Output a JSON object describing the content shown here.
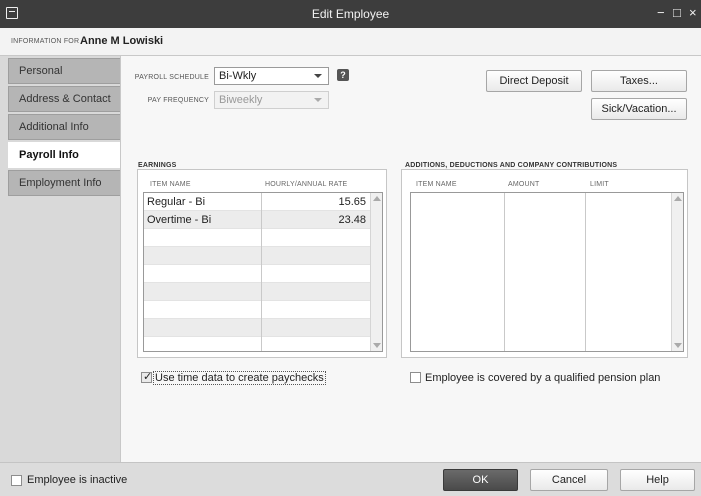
{
  "window": {
    "title": "Edit Employee",
    "controls": [
      "−",
      "□",
      "×"
    ]
  },
  "info": {
    "label": "INFORMATION FOR",
    "employee_name": "Anne M Lowiski"
  },
  "sidebar": {
    "tabs": [
      {
        "label": "Personal",
        "active": false
      },
      {
        "label": "Address & Contact",
        "active": false
      },
      {
        "label": "Additional Info",
        "active": false
      },
      {
        "label": "Payroll Info",
        "active": true
      },
      {
        "label": "Employment Info",
        "active": false
      }
    ]
  },
  "payroll": {
    "schedule_label": "PAYROLL SCHEDULE",
    "schedule_value": "Bi-Wkly",
    "help": "?",
    "frequency_label": "PAY FREQUENCY",
    "frequency_value": "Biweekly",
    "buttons": {
      "direct_deposit": "Direct Deposit",
      "taxes": "Taxes...",
      "sick_vacation": "Sick/Vacation..."
    }
  },
  "earnings": {
    "title": "EARNINGS",
    "col_item": "ITEM NAME",
    "col_rate": "HOURLY/ANNUAL RATE",
    "rows": [
      {
        "item": "Regular - Bi",
        "rate": "15.65"
      },
      {
        "item": "Overtime - Bi",
        "rate": "23.48"
      }
    ]
  },
  "additions": {
    "title": "ADDITIONS, DEDUCTIONS AND COMPANY CONTRIBUTIONS",
    "col_item": "ITEM NAME",
    "col_amount": "AMOUNT",
    "col_limit": "LIMIT"
  },
  "options": {
    "use_time_data": "Use time data to create paychecks",
    "use_time_data_checked": true,
    "pension": "Employee is covered by a qualified pension plan",
    "pension_checked": false
  },
  "footer": {
    "inactive": "Employee is inactive",
    "inactive_checked": false,
    "ok": "OK",
    "cancel": "Cancel",
    "help": "Help"
  }
}
